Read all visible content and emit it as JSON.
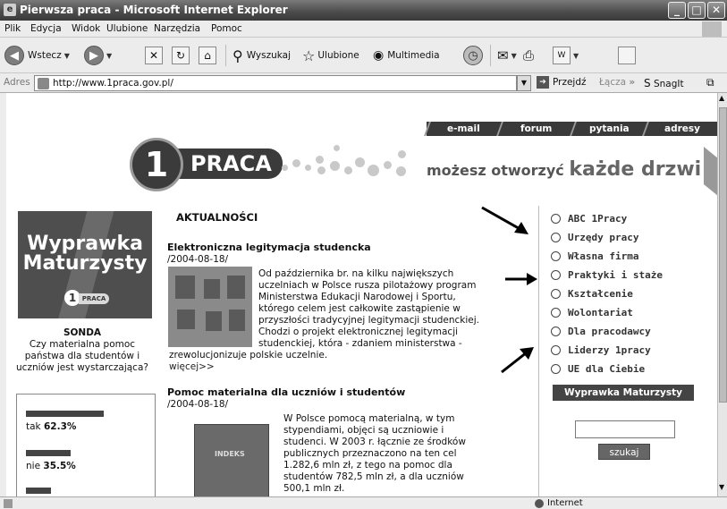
{
  "window": {
    "title": "Pierwsza praca - Microsoft Internet Explorer",
    "buttons": [
      "_",
      "□",
      "✕"
    ]
  },
  "menu": [
    "Plik",
    "Edycja",
    "Widok",
    "Ulubione",
    "Narzędzia",
    "Pomoc"
  ],
  "toolbar": {
    "back": "Wstecz",
    "search": "Wyszukaj",
    "favorites": "Ulubione",
    "media": "Multimedia"
  },
  "address": {
    "label": "Adres",
    "url": "http://www.1praca.gov.pl/",
    "go": "Przejdź",
    "links": "Łącza",
    "snagit": "SnagIt"
  },
  "site": {
    "tabs": [
      "e-mail",
      "forum",
      "pytania",
      "adresy"
    ],
    "logo_number": "1",
    "logo_text": "PRACA",
    "slogan_pre": "możesz otworzyć",
    "slogan_bold": "każde drzwi"
  },
  "left": {
    "promo_line1": "Wyprawka",
    "promo_line2": "Maturzysty",
    "promo_mini": "PRACA",
    "sonda_title": "SONDA",
    "sonda_q1": "Czy materialna pomoc",
    "sonda_q2": "państwa dla studentów i",
    "sonda_q3": "uczniów jest wystarczająca?",
    "poll": [
      {
        "label": "tak",
        "value": "62.3%",
        "fraction": 0.623
      },
      {
        "label": "nie",
        "value": "35.5%",
        "fraction": 0.355
      },
      {
        "label": "",
        "value": "",
        "fraction": 0.2
      }
    ]
  },
  "main": {
    "heading": "AKTUALNOŚCI",
    "article1": {
      "title": "Elektroniczna legitymacja studencka",
      "date": "/2004-08-18/",
      "lines": [
        "Od października br. na kilku największych",
        "uczelniach w Polsce rusza pilotażowy program",
        "Ministerstwa Edukacji Narodowej i Sportu,",
        "którego celem jest całkowite zastąpienie w",
        "przyszłości  tradycyjnej legitymacji studenckiej.",
        "Chodzi o projekt elektronicznej legitymacji",
        "studenckiej, która - zdaniem ministerstwa -"
      ],
      "last_line": "zrewolucjonizuje polskie uczelnie.",
      "more": "więcej>>"
    },
    "article2": {
      "title": "Pomoc materialna dla uczniów i studentów",
      "date": "/2004-08-18/",
      "photo_label": "INDEKS",
      "lines": [
        "W Polsce pomocą materialną, w tym",
        "stypendiami, objęci są uczniowie i",
        "studenci. W 2003 r. łącznie ze środków",
        "publicznych przeznaczono na ten cel",
        "1.282,6  mln zł, z tego na pomoc dla",
        "studentów 782,5 mln zł, a dla uczniów",
        "500,1 mln zł."
      ]
    }
  },
  "nav": {
    "items": [
      "ABC 1Pracy",
      "Urzędy pracy",
      "Własna firma",
      "Praktyki i staże",
      "Kształcenie",
      "Wolontariat",
      "Dla pracodawcy",
      "Liderzy 1pracy",
      "UE dla Ciebie"
    ],
    "promo_button": "Wyprawka Maturzysty",
    "search_button": "szukaj"
  },
  "status": {
    "zone": "Internet"
  }
}
